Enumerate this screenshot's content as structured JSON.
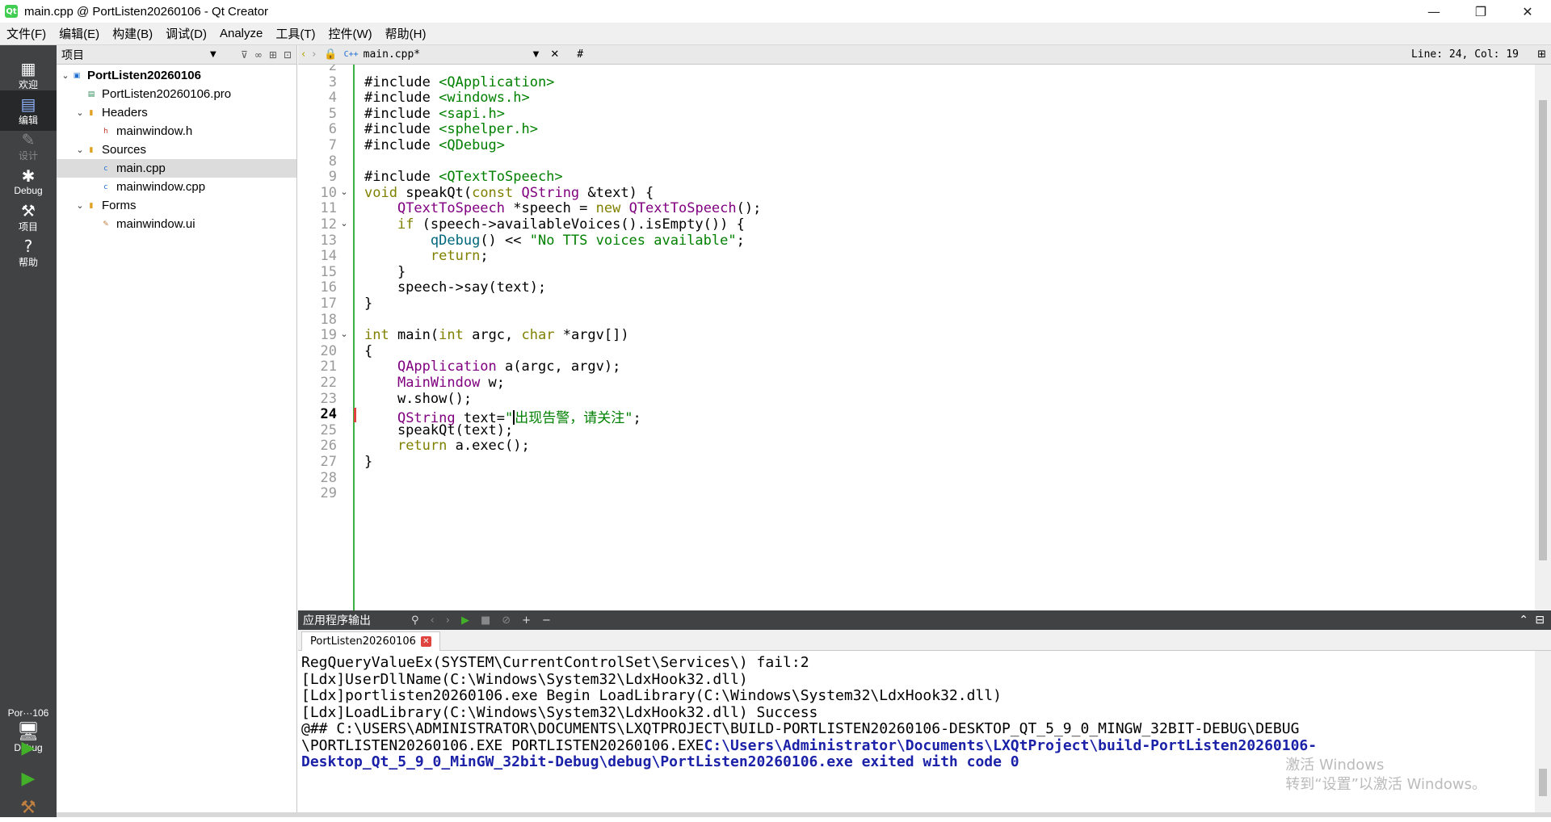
{
  "window": {
    "app_icon_text": "Qt",
    "title": "main.cpp @ PortListen20260106 - Qt Creator",
    "minimize": "—",
    "restore": "❐",
    "close": "✕"
  },
  "menu": [
    "文件(F)",
    "编辑(E)",
    "构建(B)",
    "调试(D)",
    "Analyze",
    "工具(T)",
    "控件(W)",
    "帮助(H)"
  ],
  "modes": {
    "welcome": "欢迎",
    "edit": "编辑",
    "design": "设计",
    "debug": "Debug",
    "projects": "项目",
    "help": "帮助"
  },
  "kit": {
    "project": "Por···106",
    "config": "Debug"
  },
  "project_pane": {
    "title": "项目",
    "tree": [
      {
        "label": "PortListen20260106",
        "depth": 0,
        "arrow": "⌄",
        "icon": "project-icon",
        "bold": true
      },
      {
        "label": "PortListen20260106.pro",
        "depth": 1,
        "arrow": "",
        "icon": "pro-file-icon"
      },
      {
        "label": "Headers",
        "depth": 1,
        "arrow": "⌄",
        "icon": "folder-icon"
      },
      {
        "label": "mainwindow.h",
        "depth": 2,
        "arrow": "",
        "icon": "header-file-icon"
      },
      {
        "label": "Sources",
        "depth": 1,
        "arrow": "⌄",
        "icon": "folder-icon"
      },
      {
        "label": "main.cpp",
        "depth": 2,
        "arrow": "",
        "icon": "cpp-file-icon",
        "selected": true
      },
      {
        "label": "mainwindow.cpp",
        "depth": 2,
        "arrow": "",
        "icon": "cpp-file-icon"
      },
      {
        "label": "Forms",
        "depth": 1,
        "arrow": "⌄",
        "icon": "folder-icon"
      },
      {
        "label": "mainwindow.ui",
        "depth": 2,
        "arrow": "",
        "icon": "ui-file-icon"
      }
    ]
  },
  "editor": {
    "document": "main.cpp*",
    "symbol": "#",
    "position": "Line: 24, Col: 19",
    "current_line": 24,
    "lines": [
      {
        "n": "2",
        "tokens": []
      },
      {
        "n": "3",
        "tokens": [
          {
            "c": "pp",
            "t": "#include "
          },
          {
            "c": "st",
            "t": "<QApplication>"
          }
        ]
      },
      {
        "n": "4",
        "tokens": [
          {
            "c": "pp",
            "t": "#include "
          },
          {
            "c": "st",
            "t": "<windows.h>"
          }
        ]
      },
      {
        "n": "5",
        "tokens": [
          {
            "c": "pp",
            "t": "#include "
          },
          {
            "c": "st",
            "t": "<sapi.h>"
          }
        ]
      },
      {
        "n": "6",
        "tokens": [
          {
            "c": "pp",
            "t": "#include "
          },
          {
            "c": "st",
            "t": "<sphelper.h>"
          }
        ]
      },
      {
        "n": "7",
        "tokens": [
          {
            "c": "pp",
            "t": "#include "
          },
          {
            "c": "st",
            "t": "<QDebug>"
          }
        ]
      },
      {
        "n": "8",
        "tokens": []
      },
      {
        "n": "9",
        "tokens": [
          {
            "c": "pp",
            "t": "#include "
          },
          {
            "c": "st",
            "t": "<QTextToSpeech>"
          }
        ]
      },
      {
        "n": "10",
        "fold": true,
        "tokens": [
          {
            "c": "kw",
            "t": "void"
          },
          {
            "c": "",
            "t": " speakQt("
          },
          {
            "c": "kw",
            "t": "const"
          },
          {
            "c": "",
            "t": " "
          },
          {
            "c": "ty",
            "t": "QString"
          },
          {
            "c": "",
            "t": " &text) {"
          }
        ]
      },
      {
        "n": "11",
        "tokens": [
          {
            "c": "",
            "t": "    "
          },
          {
            "c": "ty",
            "t": "QTextToSpeech"
          },
          {
            "c": "",
            "t": " *speech = "
          },
          {
            "c": "kw",
            "t": "new"
          },
          {
            "c": "",
            "t": " "
          },
          {
            "c": "ty",
            "t": "QTextToSpeech"
          },
          {
            "c": "",
            "t": "();"
          }
        ]
      },
      {
        "n": "12",
        "fold": true,
        "tokens": [
          {
            "c": "",
            "t": "    "
          },
          {
            "c": "kw",
            "t": "if"
          },
          {
            "c": "",
            "t": " (speech->availableVoices().isEmpty()) {"
          }
        ]
      },
      {
        "n": "13",
        "tokens": [
          {
            "c": "",
            "t": "        "
          },
          {
            "c": "fn",
            "t": "qDebug"
          },
          {
            "c": "",
            "t": "() << "
          },
          {
            "c": "st",
            "t": "\"No TTS voices available\""
          },
          {
            "c": "",
            "t": ";"
          }
        ]
      },
      {
        "n": "14",
        "tokens": [
          {
            "c": "",
            "t": "        "
          },
          {
            "c": "kw",
            "t": "return"
          },
          {
            "c": "",
            "t": ";"
          }
        ]
      },
      {
        "n": "15",
        "tokens": [
          {
            "c": "",
            "t": "    }"
          }
        ]
      },
      {
        "n": "16",
        "tokens": [
          {
            "c": "",
            "t": "    speech->say(text);"
          }
        ]
      },
      {
        "n": "17",
        "tokens": [
          {
            "c": "",
            "t": "}"
          }
        ]
      },
      {
        "n": "18",
        "tokens": []
      },
      {
        "n": "19",
        "fold": true,
        "tokens": [
          {
            "c": "kw",
            "t": "int"
          },
          {
            "c": "",
            "t": " main("
          },
          {
            "c": "kw",
            "t": "int"
          },
          {
            "c": "",
            "t": " argc, "
          },
          {
            "c": "kw",
            "t": "char"
          },
          {
            "c": "",
            "t": " *argv[])"
          }
        ]
      },
      {
        "n": "20",
        "tokens": [
          {
            "c": "",
            "t": "{"
          }
        ]
      },
      {
        "n": "21",
        "tokens": [
          {
            "c": "",
            "t": "    "
          },
          {
            "c": "ty",
            "t": "QApplication"
          },
          {
            "c": "",
            "t": " a(argc, argv);"
          }
        ]
      },
      {
        "n": "22",
        "tokens": [
          {
            "c": "",
            "t": "    "
          },
          {
            "c": "ty",
            "t": "MainWindow"
          },
          {
            "c": "",
            "t": " w;"
          }
        ]
      },
      {
        "n": "23",
        "tokens": [
          {
            "c": "",
            "t": "    w.show();"
          }
        ]
      },
      {
        "n": "24",
        "tokens": [
          {
            "c": "",
            "t": "    "
          },
          {
            "c": "ty",
            "t": "QString"
          },
          {
            "c": "",
            "t": " text="
          },
          {
            "c": "st",
            "t": "\""
          },
          {
            "c": "caret",
            "t": ""
          },
          {
            "c": "st",
            "t": "出现告警，请关注\""
          },
          {
            "c": "",
            "t": ";"
          }
        ]
      },
      {
        "n": "25",
        "tokens": [
          {
            "c": "",
            "t": "    speakQt(text);"
          }
        ]
      },
      {
        "n": "26",
        "tokens": [
          {
            "c": "",
            "t": "    "
          },
          {
            "c": "kw",
            "t": "return"
          },
          {
            "c": "",
            "t": " a.exec();"
          }
        ]
      },
      {
        "n": "27",
        "tokens": [
          {
            "c": "",
            "t": "}"
          }
        ]
      },
      {
        "n": "28",
        "tokens": []
      },
      {
        "n": "29",
        "tokens": []
      }
    ]
  },
  "output": {
    "title": "应用程序输出",
    "tab": "PortListen20260106",
    "lines": [
      {
        "plain": "RegQueryValueEx(SYSTEM\\CurrentControlSet\\Services\\) fail:2",
        "bold": ""
      },
      {
        "plain": "[Ldx]UserDllName(C:\\Windows\\System32\\LdxHook32.dll)",
        "bold": ""
      },
      {
        "plain": "[Ldx]portlisten20260106.exe Begin LoadLibrary(C:\\Windows\\System32\\LdxHook32.dll)",
        "bold": ""
      },
      {
        "plain": "[Ldx]LoadLibrary(C:\\Windows\\System32\\LdxHook32.dll) Success",
        "bold": ""
      },
      {
        "plain": "@## C:\\USERS\\ADMINISTRATOR\\DOCUMENTS\\LXQTPROJECT\\BUILD-PORTLISTEN20260106-DESKTOP_QT_5_9_0_MINGW_32BIT-DEBUG\\DEBUG",
        "bold": ""
      },
      {
        "plain": "\\PORTLISTEN20260106.EXE PORTLISTEN20260106.EXE",
        "bold": "C:\\Users\\Administrator\\Documents\\LXQtProject\\build-PortListen20260106-"
      },
      {
        "plain": "",
        "bold": "Desktop_Qt_5_9_0_MinGW_32bit-Debug\\debug\\PortListen20260106.exe exited with code 0"
      }
    ],
    "watermark_line1": "激活 Windows",
    "watermark_line2": "转到“设置”以激活 Windows。"
  }
}
